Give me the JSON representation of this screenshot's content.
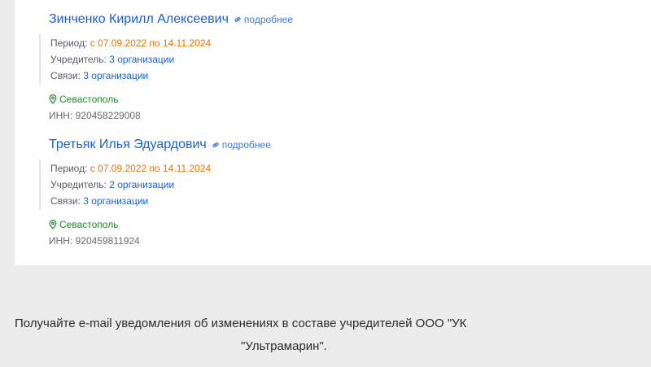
{
  "persons": [
    {
      "name": "Зинченко Кирилл Алексеевич",
      "more_label": "подробнее",
      "period_label": "Период:",
      "period_value": "с 07.09.2022 по 14.11.2024",
      "founder_label": "Учредитель:",
      "founder_value": "3 организации",
      "links_label": "Связи:",
      "links_value": "3 организации",
      "city": "Севастополь",
      "inn": "ИНН: 920458229008"
    },
    {
      "name": "Третьяк Илья Эдуардович",
      "more_label": "подробнее",
      "period_label": "Период:",
      "period_value": "с 07.09.2022 по 14.11.2024",
      "founder_label": "Учредитель:",
      "founder_value": "2 организации",
      "links_label": "Связи:",
      "links_value": "3 организации",
      "city": "Севастополь",
      "inn": "ИНН: 920459811924"
    }
  ],
  "notice": {
    "line1": "Получайте e-mail уведомления об изменениях в составе учредителей ООО \"УК",
    "line2": "\"Ультрамарин\"."
  },
  "icons": {
    "more": "link-icon",
    "location": "map-pin-icon"
  },
  "colors": {
    "name_link": "#1a5fd1",
    "period": "#f07000",
    "location": "#1d8a2b",
    "background": "#ececec"
  }
}
